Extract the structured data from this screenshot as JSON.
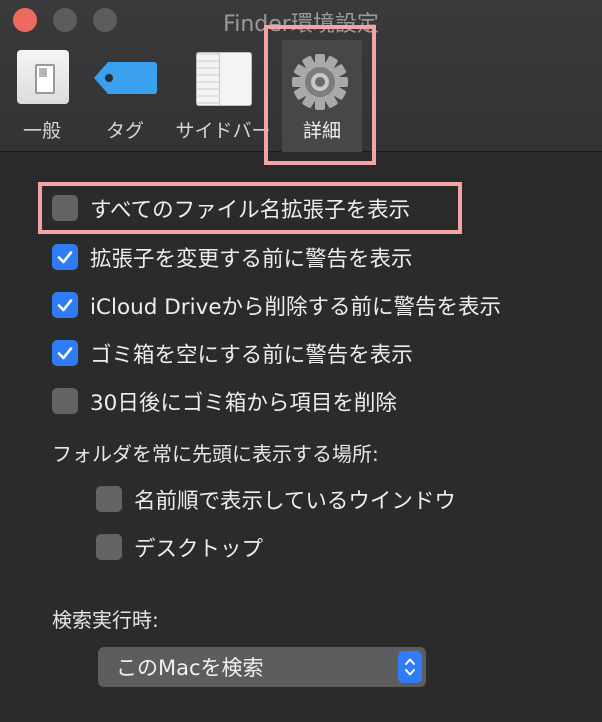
{
  "window": {
    "title": "Finder環境設定"
  },
  "tabs": [
    {
      "label": "一般",
      "icon": "general-switch-icon"
    },
    {
      "label": "タグ",
      "icon": "tag-icon"
    },
    {
      "label": "サイドバー",
      "icon": "sidebar-icon"
    },
    {
      "label": "詳細",
      "icon": "gear-icon",
      "selected": true
    }
  ],
  "options": [
    {
      "label": "すべてのファイル名拡張子を表示",
      "checked": false
    },
    {
      "label": "拡張子を変更する前に警告を表示",
      "checked": true
    },
    {
      "label": "iCloud Driveから削除する前に警告を表示",
      "checked": true
    },
    {
      "label": "ゴミ箱を空にする前に警告を表示",
      "checked": true
    },
    {
      "label": "30日後にゴミ箱から項目を削除",
      "checked": false
    }
  ],
  "folders_on_top": {
    "heading": "フォルダを常に先頭に表示する場所:",
    "options": [
      {
        "label": "名前順で表示しているウインドウ",
        "checked": false
      },
      {
        "label": "デスクトップ",
        "checked": false
      }
    ]
  },
  "search": {
    "heading": "検索実行時:",
    "selected": "このMacを検索"
  },
  "colors": {
    "accent": "#2f7cf6",
    "highlight": "#f2a5a5",
    "close": "#ed6a5e"
  }
}
